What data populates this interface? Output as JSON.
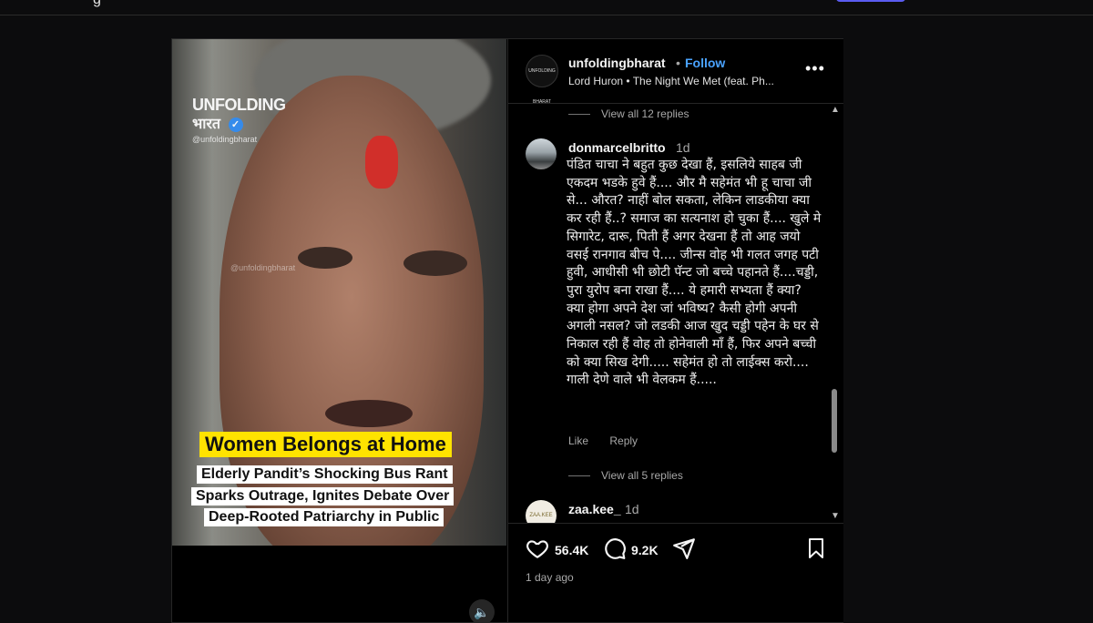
{
  "topbar": {
    "fragment": "g"
  },
  "media": {
    "logo_line1": "UNFOLDING",
    "logo_line2": "भारत",
    "overlay_handle": "@unfoldingbharat",
    "watermark": "@unfoldingbharat",
    "headline": "Women Belongs at Home",
    "subline1": "Elderly Pandit’s Shocking Bus Rant",
    "subline2": "Sparks Outrage, Ignites Debate Over",
    "subline3": "Deep-Rooted Patriarchy in Public",
    "audio_icon": "speaker-icon"
  },
  "header": {
    "avatar_text": "UNFOLDING BHARAT",
    "username": "unfoldingbharat",
    "separator": "•",
    "follow_label": "Follow",
    "audio": "Lord Huron • The Night We Met (feat. Ph...",
    "more_label": "•••"
  },
  "comments": {
    "view_replies_1": "View all 12 replies",
    "comment1": {
      "user": "donmarcelbritto",
      "time": "1d",
      "text": "पंडित चाचा ने बहुत कुछ देखा हैं, इसलिये साहब जी एकदम भडके हुवे हैं.... और मै सहेमंत भी हू चाचा जी से... औरत? नाहीं बोल सकता, लेकिन लाडकीया क्या कर रही हैं..? समाज का सत्यनाश हो चुका हैं.... खुले मे सिगारेट, दारू, पिती हैं अगर देखना हैं तो आह जयो वसई रानगाव बीच पे.... जीन्स वोह भी गलत जगह पटी हुवी, आधीसी भी छोटी पॅन्ट जो बच्चे पहानते हैं....चड्डी, पुरा युरोप बना राखा हैं.... ये हमारी सभ्यता हैं क्या? क्या होगा अपने देश जां भविष्य? कैसी होगी अपनी अगली नसल? जो लडकी आज खुद चड्डी पहेन के घर से निकाल रही हैं वोह तो होनेवाली माँ हैं, फिर अपने बच्ची को क्या सिख देगी..... सहेमंत हो तो लाईक्स करो.... गाली देणे वाले भी वेलकम हैं.....",
      "like_label": "Like",
      "reply_label": "Reply"
    },
    "view_replies_2": "View all 5 replies",
    "comment2": {
      "user": "zaa.kee_",
      "time": "1d",
      "avatar_text": "ZAA.KEE"
    }
  },
  "actions": {
    "likes": "56.4K",
    "comments": "9.2K",
    "posted": "1 day ago"
  },
  "colors": {
    "follow": "#4aa3ff",
    "headline_bg": "#ffe300",
    "background": "#0c0c0d"
  }
}
